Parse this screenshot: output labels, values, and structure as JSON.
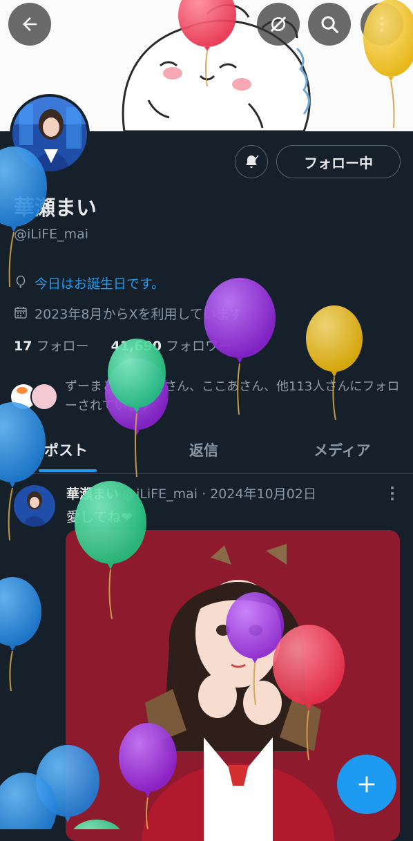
{
  "profile": {
    "name": "華瀬まい",
    "handle": "@iLiFE_mai",
    "birthday_text": "今日はお誕生日です。",
    "joined_text": "2023年8月からXを利用しています",
    "following_count": "17",
    "following_label": "フォロー",
    "followers_count": "41,690",
    "followers_label": "フォロワー",
    "followed_by_text": "ずーまとらんせ霊さん、ここあさん、他113人さんにフォローされています"
  },
  "actions": {
    "follow_label": "フォロー中"
  },
  "tabs": [
    {
      "label": "ポスト",
      "active": true
    },
    {
      "label": "返信",
      "active": false
    },
    {
      "label": "メディア",
      "active": false
    }
  ],
  "post": {
    "author": "華瀬まい",
    "meta": "@iLiFE_mai · 2024年10月02日",
    "text": "愛してね❤"
  },
  "icons": {
    "back": "back-arrow-icon",
    "grok": "grok-icon",
    "search": "search-icon",
    "more": "more-icon",
    "bell": "bell-icon",
    "balloon_location": "balloon-icon",
    "calendar": "calendar-icon",
    "compose": "plus-icon"
  },
  "colors": {
    "background": "#15202b",
    "accent": "#1d9bf0",
    "text": "#e7e9ea",
    "muted": "#8b98a5",
    "balloon_red": "#f0415a",
    "balloon_blue": "#2b8fe0",
    "balloon_purple": "#9b2fd8",
    "balloon_green": "#2fd28f",
    "balloon_yellow": "#f2c012"
  }
}
